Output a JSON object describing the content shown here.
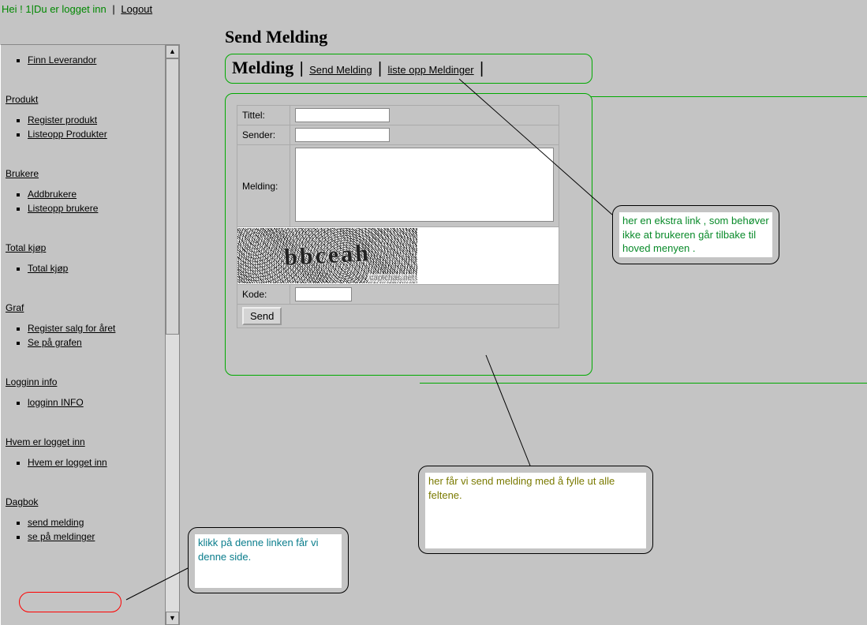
{
  "header": {
    "greeting": "Hei ! 1",
    "status": "Du er logget inn",
    "logout": "Logout"
  },
  "sidebar": {
    "top_items": [
      "Finn Leverandor"
    ],
    "sections": [
      {
        "title": "Produkt",
        "items": [
          "Register produkt",
          "Listeopp Produkter"
        ]
      },
      {
        "title": "Brukere",
        "items": [
          "Addbrukere",
          "Listeopp brukere"
        ]
      },
      {
        "title": "Total kjøp",
        "items": [
          "Total kjøp"
        ]
      },
      {
        "title": "Graf",
        "items": [
          "Register salg for året",
          "Se på grafen"
        ]
      },
      {
        "title": "Logginn info",
        "items": [
          "logginn INFO"
        ]
      },
      {
        "title": "Hvem er logget inn",
        "items": [
          "Hvem er logget inn"
        ]
      },
      {
        "title": "Dagbok",
        "items": [
          "send melding",
          "se på meldinger"
        ]
      }
    ]
  },
  "page": {
    "title": "Send Melding",
    "nav_title": "Melding",
    "nav_links": [
      "Send Melding",
      "liste opp Meldinger"
    ]
  },
  "form": {
    "tittel_label": "Tittel:",
    "sender_label": "Sender:",
    "melding_label": "Melding:",
    "kode_label": "Kode:",
    "send_label": "Send",
    "captcha_text": "bbceah",
    "captcha_credit": "captchas.net"
  },
  "annotations": {
    "right": "her en ekstra link , som behøver ikke at brukeren går tilbake til hoved menyen .",
    "bottom": "her får vi send melding med å fylle ut alle feltene.",
    "left": "klikk på denne linken får vi denne side."
  }
}
